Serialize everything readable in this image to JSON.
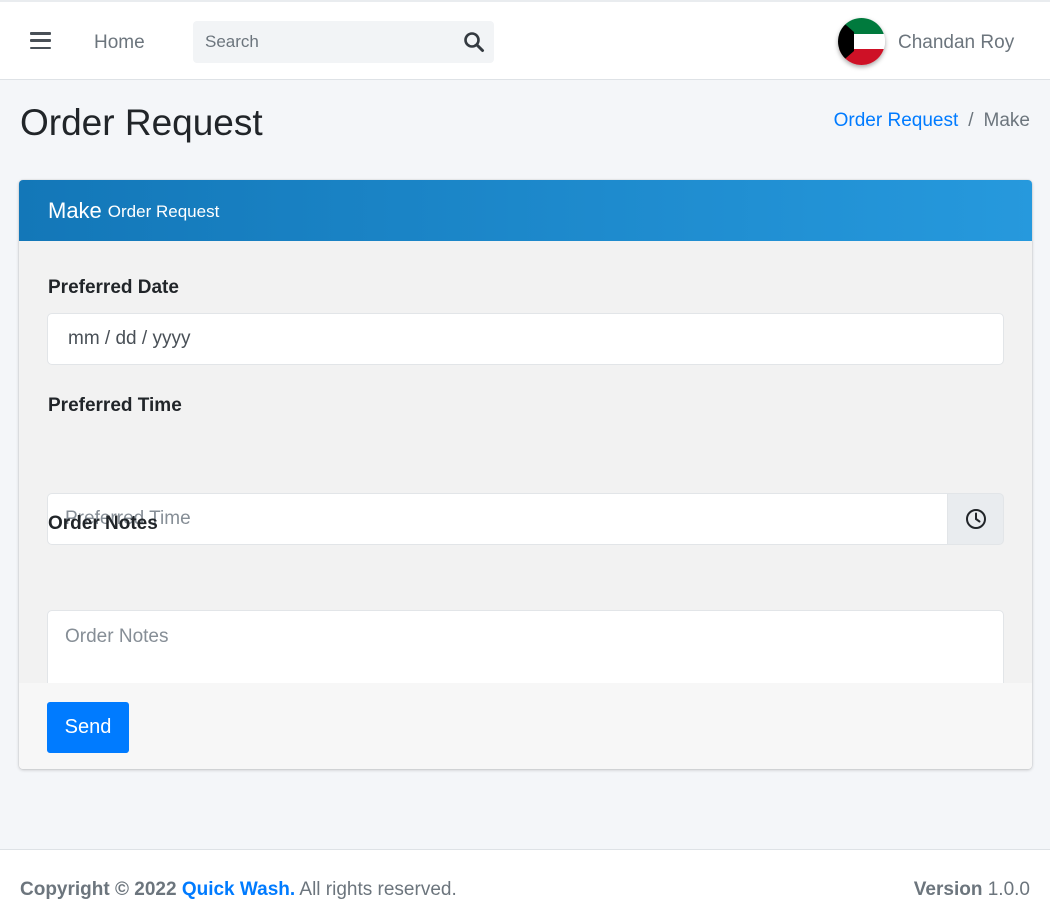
{
  "navbar": {
    "home_label": "Home",
    "search_placeholder": "Search",
    "user_name": "Chandan Roy",
    "icons": {
      "menu": "hamburger-icon",
      "search": "search-icon",
      "avatar": "kuwait-flag-avatar"
    }
  },
  "header": {
    "title": "Order Request",
    "breadcrumb": {
      "link": "Order Request",
      "separator": "/",
      "active": "Make"
    }
  },
  "card": {
    "title_main": "Make",
    "title_sub": "Order Request",
    "header_color": "#1e88cf",
    "fields": {
      "date": {
        "label": "Preferred Date",
        "placeholder": "mm / dd / yyyy",
        "value": ""
      },
      "time": {
        "label": "Preferred Time",
        "placeholder": "Preferred Time",
        "value": "",
        "icon": "clock-icon"
      },
      "notes": {
        "label": "Order Notes",
        "placeholder": "Order Notes",
        "value": ""
      }
    },
    "submit_label": "Send",
    "submit_color": "#007bff"
  },
  "footer": {
    "copyright_prefix": "Copyright © 2022",
    "brand": "Quick Wash.",
    "rights": "All rights reserved.",
    "version_label": "Version",
    "version_number": "1.0.0"
  }
}
